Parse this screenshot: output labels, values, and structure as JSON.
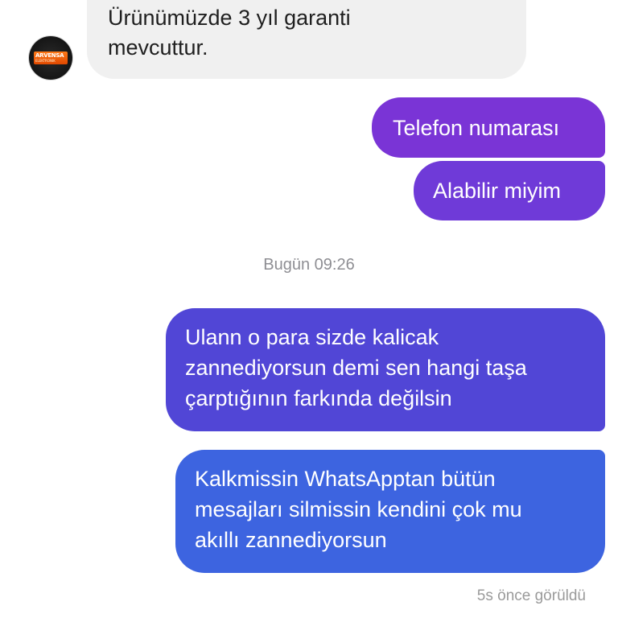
{
  "messages": {
    "incoming": {
      "lines": [
        "Ürünümüzde 3 yıl garanti",
        "mevcuttur."
      ],
      "avatar_text": "ARVENSA",
      "avatar_sub": "ELEKTRONIK"
    },
    "outgoing_1": {
      "text": "Telefon numarası"
    },
    "outgoing_2": {
      "text": "Alabilir miyim"
    },
    "timestamp": "Bugün 09:26",
    "outgoing_3": {
      "lines": [
        "Ulann o para sizde kalicak",
        "zannediyorsun demi sen hangi taşa",
        "çarptığının farkında değilsin"
      ]
    },
    "outgoing_4": {
      "lines": [
        "Kalkmissin WhatsApptan bütün",
        "mesajları silmissin kendini çok mu",
        "akıllı zannediyorsun"
      ]
    },
    "seen_status": "5s önce görüldü"
  },
  "colors": {
    "incoming_bubble": "#f0f0f0",
    "outgoing_purple": "#7a34d6",
    "outgoing_violet": "#5146d6",
    "outgoing_blue": "#3d64e0",
    "meta_text": "#8e8e93"
  }
}
